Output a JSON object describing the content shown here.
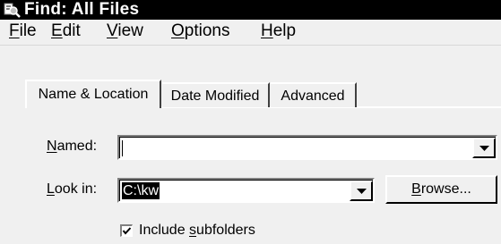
{
  "window": {
    "title": "Find: All Files"
  },
  "menu": [
    {
      "key": "F",
      "rest": "ile"
    },
    {
      "key": "E",
      "rest": "dit"
    },
    {
      "key": "V",
      "rest": "iew"
    },
    {
      "key": "O",
      "rest": "ptions"
    },
    {
      "key": "H",
      "rest": "elp"
    }
  ],
  "tabs": {
    "name_location": "Name & Location",
    "date_modified": "Date Modified",
    "advanced": "Advanced"
  },
  "named": {
    "key": "N",
    "rest": "amed:",
    "value": ""
  },
  "look_in": {
    "key": "L",
    "rest": "ook in:",
    "value": "C:\\kw"
  },
  "browse": {
    "key": "B",
    "rest": "rowse..."
  },
  "include_subfolders": {
    "pre": "Include ",
    "key": "s",
    "rest": "ubfolders",
    "checked": true
  },
  "colors": {
    "titlebar": "#000000",
    "face": "#f0f0f0",
    "selection": "#000000"
  },
  "icons": {
    "title": "find-files-icon",
    "dropdown": "chevron-down-icon",
    "check": "check-icon"
  }
}
